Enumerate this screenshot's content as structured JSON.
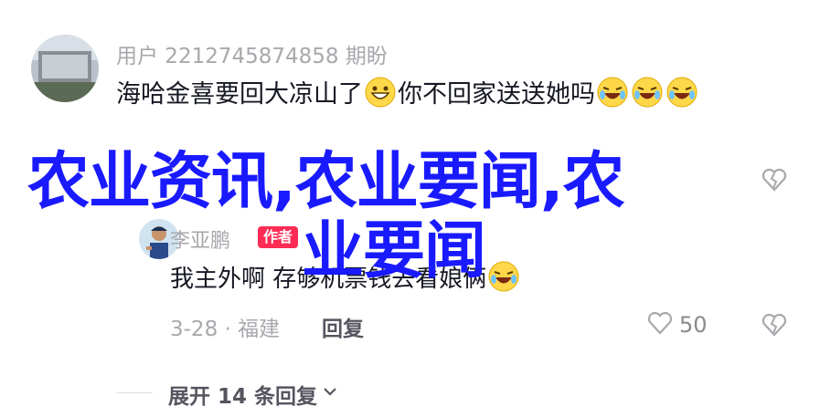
{
  "main_comment": {
    "username": "用户 2212745874858 期盼",
    "text_part1": "海哈金喜要回大凉山了",
    "text_part2": "你不回家送送她吗",
    "date_location": "",
    "reply_label": ""
  },
  "reply_comment": {
    "username": "李亚鹏",
    "author_badge": "作者",
    "text": "我主外啊 存够机票钱去看娘俩",
    "date_location": "3-28 · 福建",
    "reply_label": "回复",
    "like_count": "50"
  },
  "expand_label": "展开 14 条回复",
  "overlay": {
    "line1": "农业资讯,农业要闻,农",
    "line2": "业要闻"
  },
  "colors": {
    "overlay_text": "#1a1aff",
    "author_badge_bg": "#fe2c55",
    "secondary_text": "#a8a8ad",
    "primary_text": "#161823"
  },
  "icons": [
    "grin-emoji-icon",
    "laughing-emoji-icon",
    "heart-icon",
    "broken-heart-icon",
    "chevron-down-icon"
  ]
}
